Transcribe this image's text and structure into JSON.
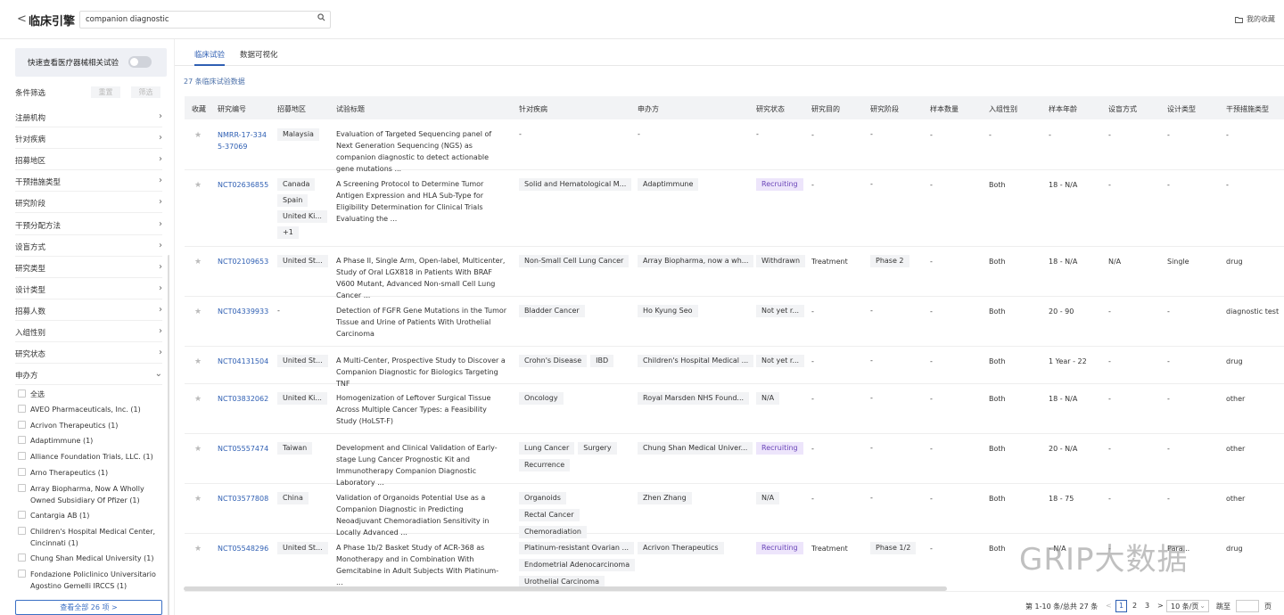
{
  "header": {
    "back_glyph": "<",
    "title": "临床引擎",
    "search_value": "companion diagnostic",
    "favorites_label": "我的收藏"
  },
  "sidebar": {
    "quick_toggle_label": "快速查看医疗器械相关试验",
    "filter_heading": "条件筛选",
    "reset_label": "重置",
    "filter_label": "筛选",
    "facets": [
      "注册机构",
      "针对疾病",
      "招募地区",
      "干预措施类型",
      "研究阶段",
      "干预分配方法",
      "设盲方式",
      "研究类型",
      "设计类型",
      "招募人数",
      "入组性别",
      "研究状态",
      "申办方"
    ],
    "sponsor_options": [
      "全选",
      "AVEO Pharmaceuticals, Inc. (1)",
      "Acrivon Therapeutics (1)",
      "Adaptimmune (1)",
      "Alliance Foundation Trials, LLC. (1)",
      "Arno Therapeutics (1)",
      "Array Biopharma, Now A Wholly Owned Subsidiary Of Pfizer (1)",
      "Cantargia AB (1)",
      "Children's Hospital Medical Center, Cincinnati (1)",
      "Chung Shan Medical University (1)",
      "Fondazione Policlinico Universitario Agostino Gemelli IRCCS (1)"
    ],
    "view_all_label": "查看全部 26 项  >"
  },
  "main": {
    "tabs": [
      "临床试验",
      "数据可视化"
    ],
    "count_label": "27 条临床试验数据",
    "columns": [
      "收藏",
      "研究编号",
      "招募地区",
      "试验标题",
      "针对疾病",
      "申办方",
      "研究状态",
      "研究目的",
      "研究阶段",
      "样本数量",
      "入组性别",
      "样本年龄",
      "设盲方式",
      "设计类型",
      "干预措施类型"
    ],
    "rows": [
      {
        "id": "NMRR-17-3345-37069",
        "regions": [
          "Malaysia"
        ],
        "title": "Evaluation of Targeted Sequencing panel of Next Generation Sequencing (NGS) as companion diagnostic to detect actionable gene mutations ...",
        "diseases": [],
        "sponsor": "-",
        "status": "-",
        "status_type": "none",
        "purpose": "-",
        "phase": "-",
        "sample": "-",
        "gender": "-",
        "age": "-",
        "blinding": "-",
        "design": "-",
        "intervention": "-"
      },
      {
        "id": "NCT02636855",
        "regions": [
          "Canada",
          "Spain",
          "United Ki...",
          "+1"
        ],
        "title": "A Screening Protocol to Determine Tumor Antigen Expression and HLA Sub-Type for Eligibility Determination for Clinical Trials Evaluating the ...",
        "diseases": [
          "Solid and Hematological M..."
        ],
        "sponsor": "Adaptimmune",
        "status": "Recruiting",
        "status_type": "rec",
        "purpose": "-",
        "phase": "-",
        "sample": "-",
        "gender": "Both",
        "age": "18 - N/A",
        "blinding": "-",
        "design": "-",
        "intervention": "-"
      },
      {
        "id": "NCT02109653",
        "regions": [
          "United St..."
        ],
        "title": "A Phase II, Single Arm, Open-label, Multicenter, Study of Oral LGX818 in Patients With BRAF V600 Mutant, Advanced Non-small Cell Lung Cancer ...",
        "diseases": [
          "Non-Small Cell Lung Cancer"
        ],
        "sponsor": "Array Biopharma, now a wh...",
        "status": "Withdrawn",
        "status_type": "tag",
        "purpose": "Treatment",
        "phase": "Phase 2",
        "sample": "-",
        "gender": "Both",
        "age": "18 - N/A",
        "blinding": "N/A",
        "design": "Single",
        "intervention": "drug"
      },
      {
        "id": "NCT04339933",
        "regions": [
          "-"
        ],
        "title": "Detection of FGFR Gene Mutations in the Tumor Tissue and Urine of Patients With Urothelial Carcinoma",
        "diseases": [
          "Bladder Cancer"
        ],
        "sponsor": "Ho Kyung Seo",
        "status": "Not yet r...",
        "status_type": "tag",
        "purpose": "-",
        "phase": "-",
        "sample": "-",
        "gender": "Both",
        "age": "20 - 90",
        "blinding": "-",
        "design": "-",
        "intervention": "diagnostic test"
      },
      {
        "id": "NCT04131504",
        "regions": [
          "United St..."
        ],
        "title": "A Multi-Center, Prospective Study to Discover a Companion Diagnostic for Biologics Targeting TNF",
        "diseases": [
          "Crohn's Disease",
          "IBD"
        ],
        "sponsor": "Children's Hospital Medical ...",
        "status": "Not yet r...",
        "status_type": "tag",
        "purpose": "-",
        "phase": "-",
        "sample": "-",
        "gender": "Both",
        "age": "1 Year - 22",
        "blinding": "-",
        "design": "-",
        "intervention": "drug"
      },
      {
        "id": "NCT03832062",
        "regions": [
          "United Ki..."
        ],
        "title": "Homogenization of Leftover Surgical Tissue Across Multiple Cancer Types: a Feasibility Study (HoLST-F)",
        "diseases": [
          "Oncology"
        ],
        "sponsor": "Royal Marsden NHS Found...",
        "status": "N/A",
        "status_type": "tag",
        "purpose": "-",
        "phase": "-",
        "sample": "-",
        "gender": "Both",
        "age": "18 - N/A",
        "blinding": "-",
        "design": "-",
        "intervention": "other"
      },
      {
        "id": "NCT05557474",
        "regions": [
          "Taiwan"
        ],
        "title": "Development and Clinical Validation of Early-stage Lung Cancer Prognostic Kit and Immunotherapy Companion Diagnostic Laboratory ...",
        "diseases": [
          "Lung Cancer",
          "Surgery",
          "Recurrence"
        ],
        "sponsor": "Chung Shan Medical Univer...",
        "status": "Recruiting",
        "status_type": "rec",
        "purpose": "-",
        "phase": "-",
        "sample": "-",
        "gender": "Both",
        "age": "20 - N/A",
        "blinding": "-",
        "design": "-",
        "intervention": "other"
      },
      {
        "id": "NCT03577808",
        "regions": [
          "China"
        ],
        "title": "Validation of Organoids Potential Use as a Companion Diagnostic in Predicting Neoadjuvant Chemoradiation Sensitivity in Locally Advanced ...",
        "diseases": [
          "Organoids",
          "Rectal Cancer",
          "Chemoradiation"
        ],
        "sponsor": "Zhen Zhang",
        "status": "N/A",
        "status_type": "tag",
        "purpose": "-",
        "phase": "-",
        "sample": "-",
        "gender": "Both",
        "age": "18 - 75",
        "blinding": "-",
        "design": "-",
        "intervention": "other"
      },
      {
        "id": "NCT05548296",
        "regions": [
          "United St..."
        ],
        "title": "A Phase 1b/2 Basket Study of ACR-368 as Monotherapy and in Combination With Gemcitabine in Adult Subjects With Platinum- ...",
        "diseases": [
          "Platinum-resistant Ovarian ...",
          "Endometrial Adenocarcinoma",
          "Urothelial Carcinoma"
        ],
        "sponsor": "Acrivon Therapeutics",
        "status": "Recruiting",
        "status_type": "rec",
        "purpose": "Treatment",
        "phase": "Phase 1/2",
        "sample": "-",
        "gender": "Both",
        "age": "- N/A",
        "blinding": "-",
        "design": "Para...",
        "intervention": "drug"
      }
    ]
  },
  "pagination": {
    "summary": "第 1-10 条/总共 27 条",
    "prev": "<",
    "pages": [
      "1",
      "2",
      "3"
    ],
    "next": ">",
    "page_size": "10 条/页",
    "jump_label": "跳至",
    "page_suffix": "页"
  },
  "watermark": "GRIP大数据",
  "colors": {
    "accent": "#2f5fb3",
    "recruiting_bg": "#ede5fb",
    "recruiting_fg": "#6a45b8",
    "header_bg": "#f2f3f5"
  }
}
